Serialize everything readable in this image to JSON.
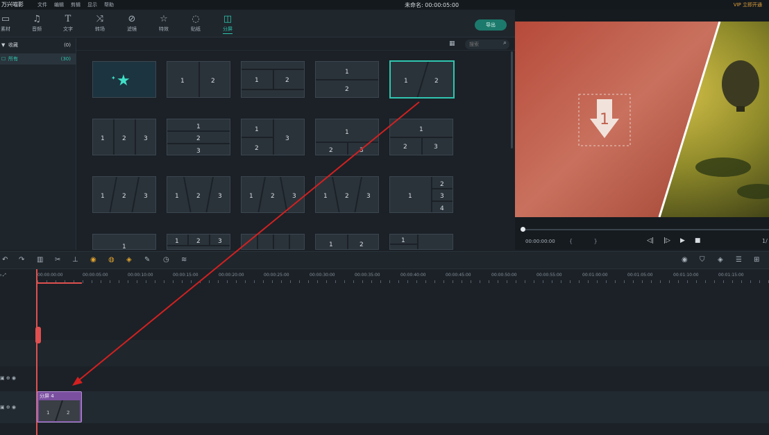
{
  "app": {
    "logo": "万兴喵影",
    "menu": [
      "文件",
      "编辑",
      "剪辑",
      "显示",
      "帮助"
    ],
    "doc_title": "未命名: 00:00:05:00",
    "vip": "VIP 立即开通"
  },
  "toolbar": {
    "items": [
      {
        "label": "素材",
        "icon": "media-icon"
      },
      {
        "label": "音频",
        "icon": "music-icon"
      },
      {
        "label": "文字",
        "icon": "text-icon"
      },
      {
        "label": "转场",
        "icon": "transition-icon"
      },
      {
        "label": "滤镜",
        "icon": "filter-icon"
      },
      {
        "label": "特效",
        "icon": "effects-icon"
      },
      {
        "label": "贴纸",
        "icon": "sticker-icon"
      },
      {
        "label": "分屏",
        "icon": "split-screen-icon",
        "active": true
      }
    ],
    "export_label": "导出"
  },
  "sidebar": {
    "items": [
      {
        "label": "收藏",
        "count": "(0)",
        "prefix": "▼"
      },
      {
        "label": "所有",
        "count": "(30)",
        "prefix": "☐",
        "selected": true
      }
    ]
  },
  "search": {
    "placeholder": "搜索"
  },
  "thumbnails": [
    [
      "★",
      "1|2",
      "1|2 (banded)",
      "1/2 stacked",
      "1 / 2 diagonal"
    ],
    [
      "1|2|3",
      "1/2/3 stacked",
      "1/2 | 3",
      "1 / 2|3",
      "1 / 2|3 (v2)"
    ],
    [
      "1/2/3 slant",
      "1\\2/3 slant",
      "1/2\\3 slant",
      "1\\2/3 v2",
      "1 | 2/3/4"
    ]
  ],
  "preview": {
    "time": "00:00:00:00",
    "brackets": "{ }",
    "ratio": "1/",
    "drop_number": "1",
    "accent": "#2fc6b0"
  },
  "ruler": {
    "ticks": [
      "00:00:00:00",
      "00:00:05:00",
      "00:00:10:00",
      "00:00:15:00",
      "00:00:20:00",
      "00:00:25:00",
      "00:00:30:00",
      "00:00:35:00",
      "00:00:40:00",
      "00:00:45:00",
      "00:00:50:00",
      "00:00:55:00",
      "00:01:00:00",
      "00:01:05:00",
      "00:01:10:00",
      "00:01:15:00"
    ]
  },
  "clip": {
    "label": "分屏 4"
  },
  "colors": {
    "accent": "#2fc6b0",
    "playhead": "#e05050",
    "clip": "#7a4fa0",
    "arrow": "#d42020"
  }
}
